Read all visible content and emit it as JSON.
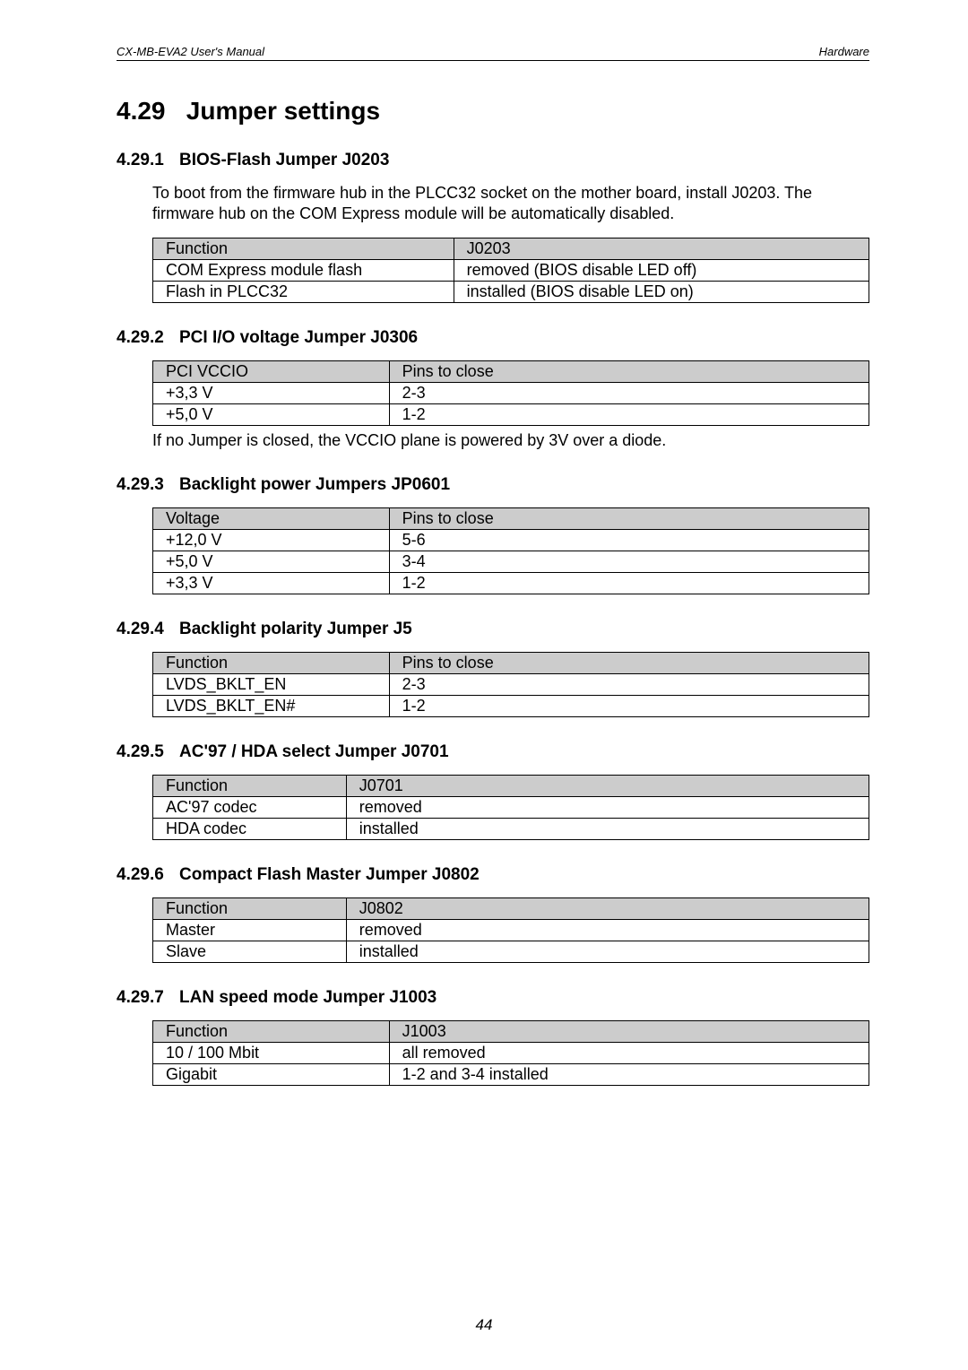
{
  "header": {
    "doc_title": "CX-MB-EVA2  User's Manual",
    "chapter": "Hardware"
  },
  "section": {
    "number": "4.29",
    "title": "Jumper settings"
  },
  "subsections": [
    {
      "number": "4.29.1",
      "title": "BIOS-Flash Jumper J0203",
      "paragraph": "To boot from the firmware hub in the PLCC32 socket on the mother board, install J0203. The firmware hub on the COM Express module will be automatically disabled.",
      "table": {
        "head": [
          "Function",
          "J0203"
        ],
        "col_widths": [
          "42%",
          "58%"
        ],
        "rows": [
          [
            "COM Express module flash",
            "removed  (BIOS disable LED off)"
          ],
          [
            "Flash in PLCC32",
            "installed  (BIOS disable LED on)"
          ]
        ]
      },
      "note": ""
    },
    {
      "number": "4.29.2",
      "title": "PCI I/O voltage Jumper J0306",
      "paragraph": "",
      "table": {
        "head": [
          "PCI VCCIO",
          "Pins to close"
        ],
        "col_widths": [
          "33%",
          "67%"
        ],
        "rows": [
          [
            "+3,3 V",
            "2-3"
          ],
          [
            "+5,0 V",
            "1-2"
          ]
        ]
      },
      "note": "If no Jumper is closed, the VCCIO plane is powered by 3V over a diode."
    },
    {
      "number": "4.29.3",
      "title": "Backlight power Jumpers JP0601",
      "paragraph": "",
      "table": {
        "head": [
          "Voltage",
          "Pins to close"
        ],
        "col_widths": [
          "33%",
          "67%"
        ],
        "rows": [
          [
            "+12,0 V",
            "5-6"
          ],
          [
            "+5,0 V",
            "3-4"
          ],
          [
            "+3,3 V",
            "1-2"
          ]
        ]
      },
      "note": ""
    },
    {
      "number": "4.29.4",
      "title": "Backlight polarity Jumper J5",
      "paragraph": "",
      "table": {
        "head": [
          "Function",
          "Pins to close"
        ],
        "col_widths": [
          "33%",
          "67%"
        ],
        "rows": [
          [
            "LVDS_BKLT_EN",
            "2-3"
          ],
          [
            "LVDS_BKLT_EN#",
            "1-2"
          ]
        ]
      },
      "note": ""
    },
    {
      "number": "4.29.5",
      "title": "AC'97 / HDA select Jumper J0701",
      "paragraph": "",
      "table": {
        "head": [
          "Function",
          "J0701"
        ],
        "col_widths": [
          "27%",
          "73%"
        ],
        "rows": [
          [
            "AC'97 codec",
            "removed"
          ],
          [
            "HDA codec",
            "installed"
          ]
        ]
      },
      "note": ""
    },
    {
      "number": "4.29.6",
      "title": "Compact Flash Master Jumper J0802",
      "paragraph": "",
      "table": {
        "head": [
          "Function",
          "J0802"
        ],
        "col_widths": [
          "27%",
          "73%"
        ],
        "rows": [
          [
            "Master",
            "removed"
          ],
          [
            "Slave",
            "installed"
          ]
        ]
      },
      "note": ""
    },
    {
      "number": "4.29.7",
      "title": "LAN speed mode Jumper J1003",
      "paragraph": "",
      "table": {
        "head": [
          "Function",
          "J1003"
        ],
        "col_widths": [
          "33%",
          "67%"
        ],
        "rows": [
          [
            "10 / 100 Mbit",
            "all removed"
          ],
          [
            "Gigabit",
            "1-2 and 3-4 installed"
          ]
        ]
      },
      "note": ""
    }
  ],
  "page_number": "44"
}
